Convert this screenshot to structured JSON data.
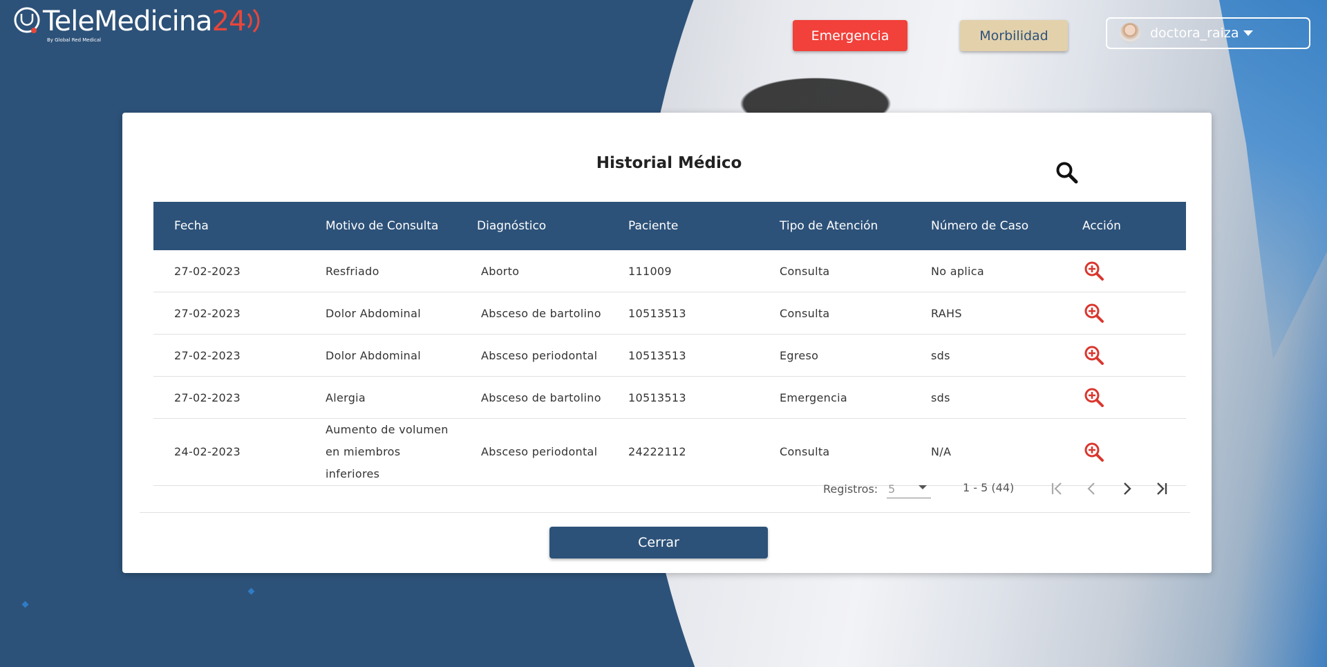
{
  "header": {
    "logo_text": "TeleMedicina",
    "logo_number": "24",
    "logo_sub": "By Global Red Medical",
    "emergency_label": "Emergencia",
    "morbidity_label": "Morbilidad",
    "username": "doctora_raiza"
  },
  "modal": {
    "title": "Historial Médico",
    "columns": [
      "Fecha",
      "Motivo de Consulta",
      "Diagnóstico",
      "Paciente",
      "Tipo de Atención",
      "Número de Caso",
      "Acción"
    ],
    "rows": [
      {
        "fecha": "27-02-2023",
        "motivo": "Resfriado",
        "diagnostico": "Aborto",
        "paciente": "111009",
        "tipo": "Consulta",
        "caso": "No aplica"
      },
      {
        "fecha": "27-02-2023",
        "motivo": "Dolor Abdominal",
        "diagnostico": "Absceso de bartolino",
        "paciente": "10513513",
        "tipo": "Consulta",
        "caso": "RAHS"
      },
      {
        "fecha": "27-02-2023",
        "motivo": "Dolor Abdominal",
        "diagnostico": "Absceso periodontal",
        "paciente": "10513513",
        "tipo": "Egreso",
        "caso": "sds"
      },
      {
        "fecha": "27-02-2023",
        "motivo": "Alergia",
        "diagnostico": "Absceso de bartolino",
        "paciente": "10513513",
        "tipo": "Emergencia",
        "caso": "sds"
      },
      {
        "fecha": "24-02-2023",
        "motivo": "Aumento de volumen en miembros inferiores",
        "diagnostico": "Absceso periodontal",
        "paciente": "24222112",
        "tipo": "Consulta",
        "caso": "N/A"
      }
    ],
    "paginator": {
      "label": "Registros:",
      "page_size": "5",
      "range": "1 - 5 (44)"
    },
    "close_label": "Cerrar"
  },
  "colors": {
    "primary": "#2d5279",
    "emergency": "#f2403a",
    "morbidity": "#e3d1ac",
    "action_icon": "#d9372e"
  },
  "icons": [
    "stethoscope-logo-icon",
    "search-icon",
    "zoom-in-icon",
    "first-page-icon",
    "prev-page-icon",
    "next-page-icon",
    "last-page-icon",
    "chevron-down-icon"
  ]
}
